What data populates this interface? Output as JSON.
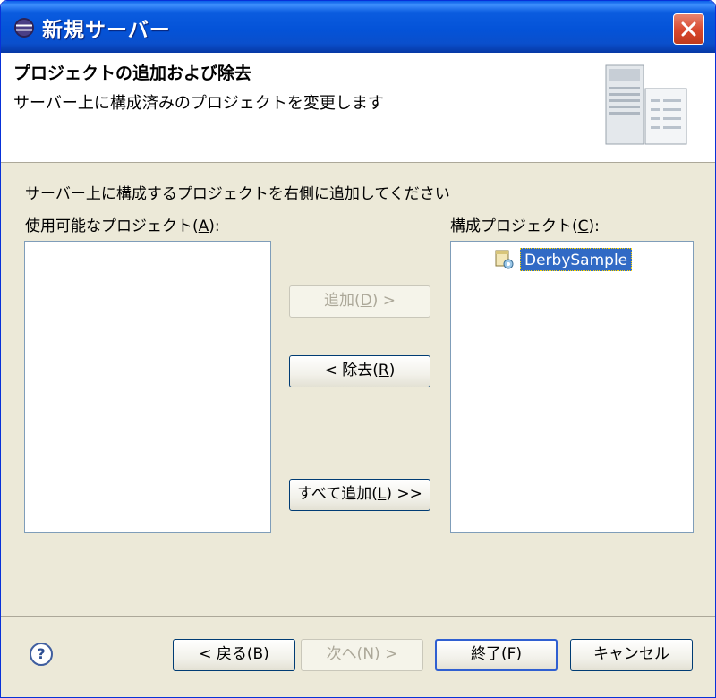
{
  "window": {
    "title": "新規サーバー"
  },
  "banner": {
    "title": "プロジェクトの追加および除去",
    "subtitle": "サーバー上に構成済みのプロジェクトを変更します"
  },
  "instruction": "サーバー上に構成するプロジェクトを右側に追加してください",
  "available": {
    "label_pre": "使用可能なプロジェクト(",
    "mnemonic": "A",
    "label_post": "):",
    "items": []
  },
  "configured": {
    "label_pre": "構成プロジェクト(",
    "mnemonic": "C",
    "label_post": "):",
    "items": [
      {
        "label": "DerbySample",
        "selected": true,
        "icon": "project-icon"
      }
    ]
  },
  "buttons": {
    "add": {
      "pre": "追加(",
      "key": "D",
      "post": ") >",
      "enabled": false
    },
    "remove": {
      "pre": "< 除去(",
      "key": "R",
      "post": ")",
      "enabled": true
    },
    "add_all": {
      "pre": "すべて追加(",
      "key": "L",
      "post": ") >>",
      "enabled": true
    }
  },
  "footer": {
    "back": {
      "pre": "< 戻る(",
      "key": "B",
      "post": ")",
      "enabled": true
    },
    "next": {
      "pre": "次へ(",
      "key": "N",
      "post": ") >",
      "enabled": false
    },
    "finish": {
      "pre": "終了(",
      "key": "F",
      "post": ")",
      "enabled": true
    },
    "cancel": {
      "label": "キャンセル",
      "enabled": true
    }
  },
  "icons": {
    "title": "eclipse-icon",
    "close": "close-icon",
    "help": "help-icon",
    "banner": "server-wizard-icon"
  },
  "colors": {
    "titlebar": "#0453d8",
    "dialog_bg": "#ece9d8",
    "selection": "#316ac5",
    "close": "#d8472c"
  }
}
